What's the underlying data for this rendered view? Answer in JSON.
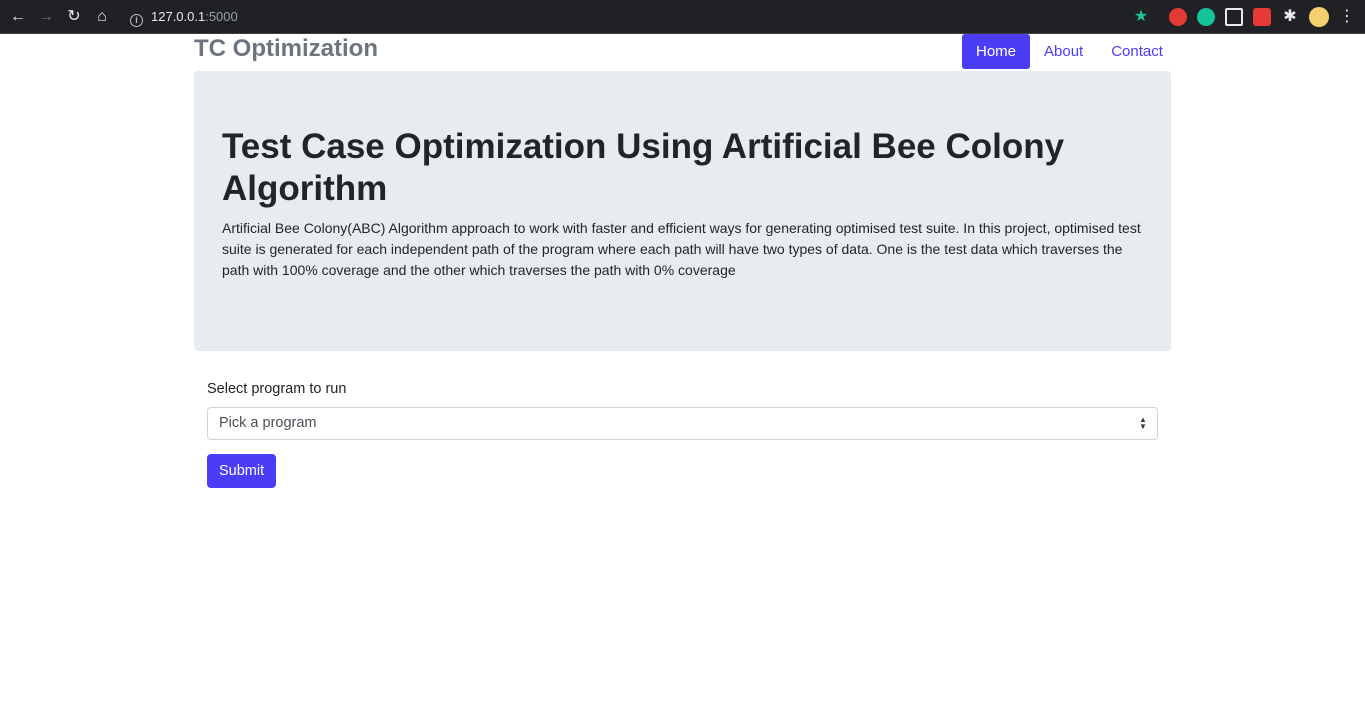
{
  "browser": {
    "url_host": "127.0.0.1",
    "url_port": ":5000"
  },
  "navbar": {
    "brand": "TC Optimization",
    "links": [
      {
        "label": "Home",
        "active": true
      },
      {
        "label": "About",
        "active": false
      },
      {
        "label": "Contact",
        "active": false
      }
    ]
  },
  "jumbotron": {
    "title": "Test Case Optimization Using Artificial Bee Colony Algorithm",
    "description": "Artificial Bee Colony(ABC) Algorithm approach to work with faster and efficient ways for generating optimised test suite. In this project, optimised test suite is generated for each independent path of the program where each path will have two types of data. One is the test data which traverses the path with 100% coverage and the other which traverses the path with 0% coverage"
  },
  "form": {
    "label": "Select program to run",
    "select_value": "Pick a program",
    "submit_label": "Submit"
  },
  "colors": {
    "primary": "#4a3df5",
    "jumbotron_bg": "#e9ecef",
    "brand": "#6c757d"
  }
}
